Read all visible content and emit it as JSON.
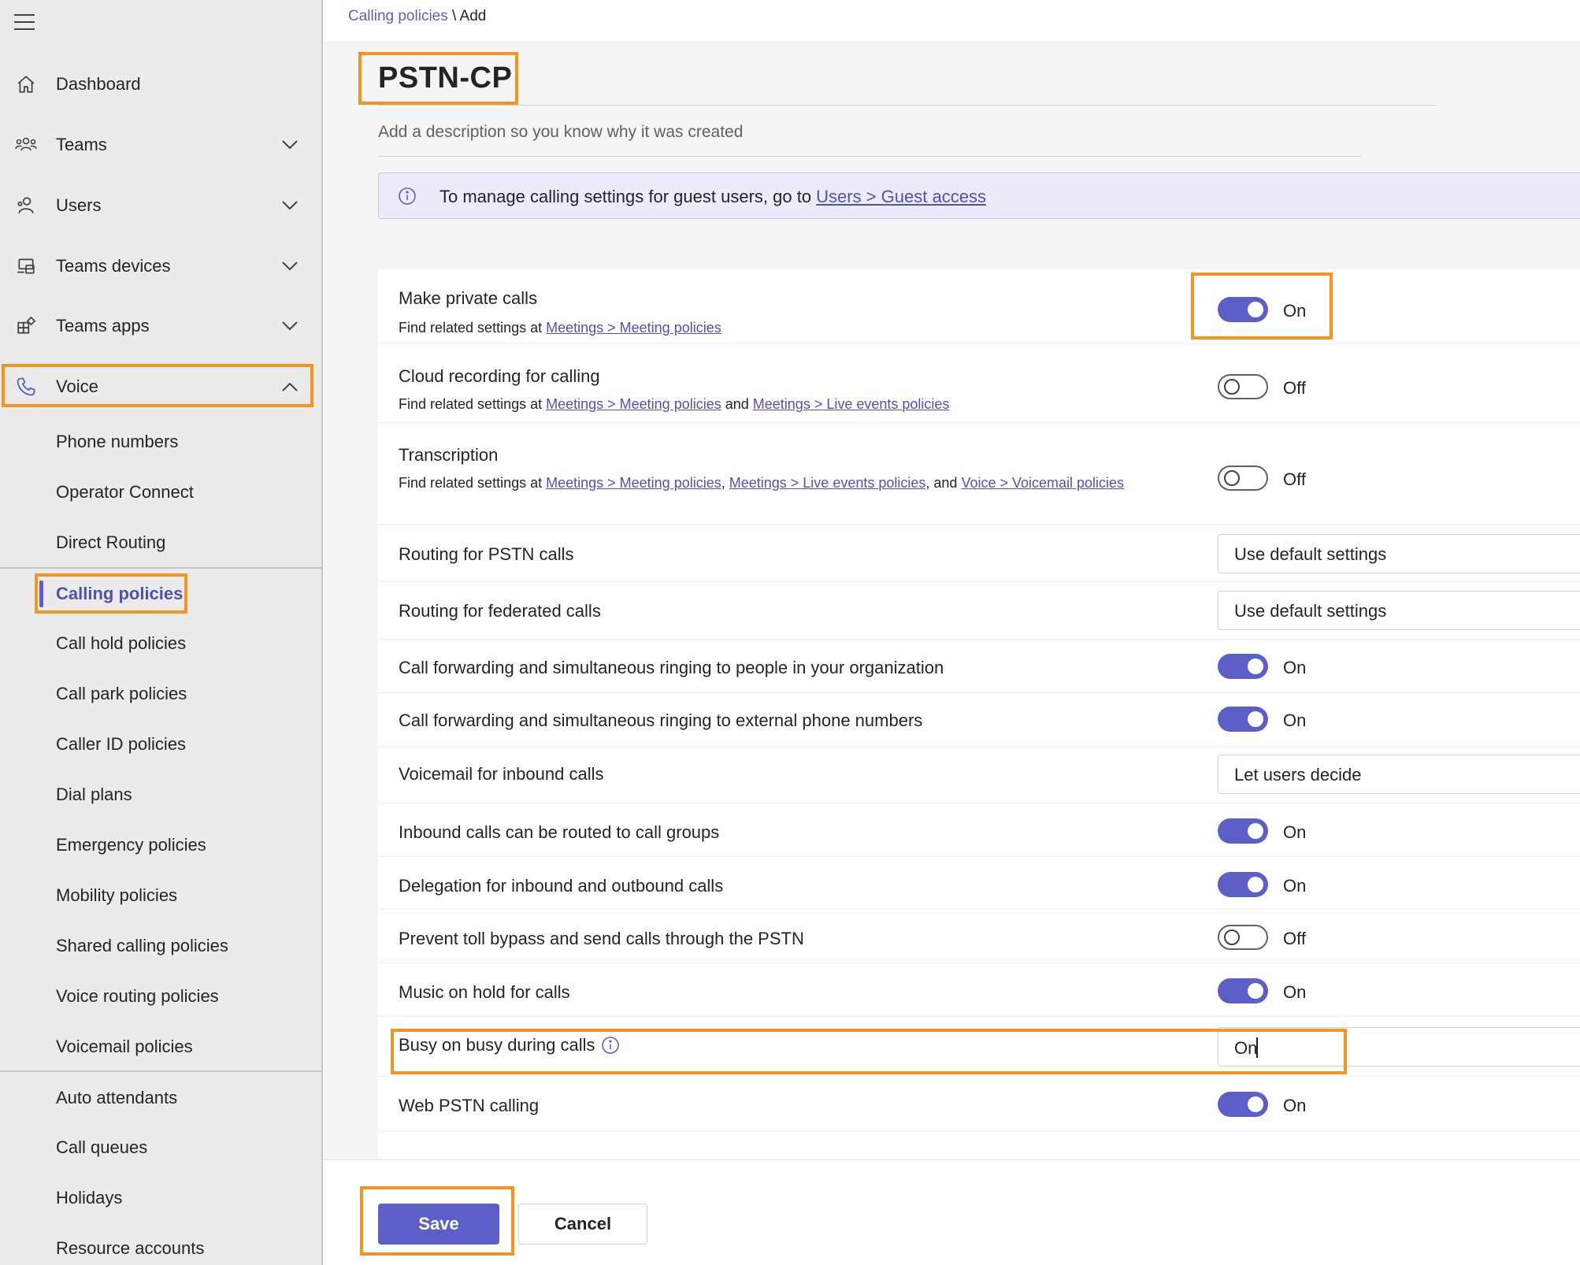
{
  "breadcrumb": {
    "parent": "Calling policies",
    "separator": " \\ ",
    "current": "Add"
  },
  "policy": {
    "name": "PSTN-CP",
    "description_placeholder": "Add a description so you know why it was created"
  },
  "info_bar": {
    "text": "To manage calling settings for guest users, go to ",
    "link": "Users > Guest access"
  },
  "sidebar": {
    "items": [
      {
        "label": "Dashboard",
        "icon": "home-icon"
      },
      {
        "label": "Teams",
        "icon": "teams-icon",
        "chevron": "down"
      },
      {
        "label": "Users",
        "icon": "users-icon",
        "chevron": "down"
      },
      {
        "label": "Teams devices",
        "icon": "devices-icon",
        "chevron": "down"
      },
      {
        "label": "Teams apps",
        "icon": "apps-icon",
        "chevron": "down"
      },
      {
        "label": "Voice",
        "icon": "phone-icon",
        "chevron": "up"
      }
    ],
    "voice_sub": [
      "Phone numbers",
      "Operator Connect",
      "Direct Routing",
      "Calling policies",
      "Call hold policies",
      "Call park policies",
      "Caller ID policies",
      "Dial plans",
      "Emergency policies",
      "Mobility policies",
      "Shared calling policies",
      "Voice routing policies",
      "Voicemail policies"
    ],
    "other_sub": [
      "Auto attendants",
      "Call queues",
      "Holidays",
      "Resource accounts"
    ]
  },
  "settings": {
    "make_private_calls": {
      "label": "Make private calls",
      "sub_prefix": "Find related settings at ",
      "link1": "Meetings > Meeting policies",
      "state": "On"
    },
    "cloud_recording": {
      "label": "Cloud recording for calling",
      "sub_prefix": "Find related settings at ",
      "link1": "Meetings > Meeting policies",
      "and": " and ",
      "link2": "Meetings > Live events policies",
      "state": "Off"
    },
    "transcription": {
      "label": "Transcription",
      "sub_prefix": "Find related settings at ",
      "link1": "Meetings > Meeting policies",
      "comma": ", ",
      "link2": "Meetings > Live events policies",
      "and": ", and ",
      "link3": "Voice > Voicemail policies",
      "state": "Off"
    },
    "routing_pstn": {
      "label": "Routing for PSTN calls",
      "value": "Use default settings"
    },
    "routing_federated": {
      "label": "Routing for federated calls",
      "value": "Use default settings"
    },
    "fwd_internal": {
      "label": "Call forwarding and simultaneous ringing to people in your organization",
      "state": "On"
    },
    "fwd_external": {
      "label": "Call forwarding and simultaneous ringing to external phone numbers",
      "state": "On"
    },
    "voicemail_inbound": {
      "label": "Voicemail for inbound calls",
      "value": "Let users decide"
    },
    "inbound_groups": {
      "label": "Inbound calls can be routed to call groups",
      "state": "On"
    },
    "delegation": {
      "label": "Delegation for inbound and outbound calls",
      "state": "On"
    },
    "toll_bypass": {
      "label": "Prevent toll bypass and send calls through the PSTN",
      "state": "Off"
    },
    "music_on_hold": {
      "label": "Music on hold for calls",
      "state": "On"
    },
    "busy_on_busy": {
      "label": "Busy on busy during calls",
      "value": "On"
    },
    "web_pstn": {
      "label": "Web PSTN calling",
      "state": "On"
    }
  },
  "footer": {
    "save": "Save",
    "cancel": "Cancel"
  },
  "colors": {
    "accent": "#5b5fc7",
    "highlight": "#f7941d",
    "link": "#4f52b2"
  }
}
